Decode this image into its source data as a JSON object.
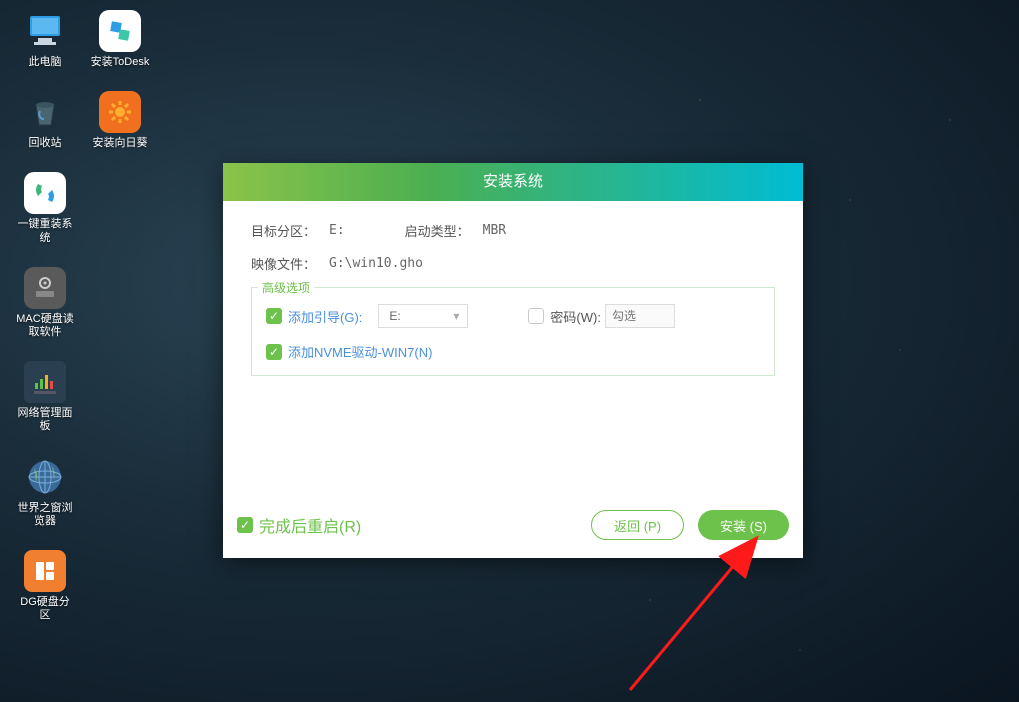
{
  "desktop": {
    "col1": [
      {
        "name": "this-pc",
        "label": "此电脑"
      },
      {
        "name": "recycle-bin",
        "label": "回收站"
      },
      {
        "name": "one-key-reinstall",
        "label": "一键重装系统"
      },
      {
        "name": "mac-disk-reader",
        "label": "MAC硬盘读取软件"
      },
      {
        "name": "network-panel",
        "label": "网络管理面板"
      },
      {
        "name": "world-window-browser",
        "label": "世界之窗浏览器"
      },
      {
        "name": "dg-disk-partition",
        "label": "DG硬盘分区"
      }
    ],
    "col2": [
      {
        "name": "install-todesk",
        "label": "安装ToDesk"
      },
      {
        "name": "install-sunflower",
        "label": "安装向日葵"
      }
    ]
  },
  "dialog": {
    "title": "安装系统",
    "target_partition_label": "目标分区：",
    "target_partition_value": "E:",
    "boot_type_label": "启动类型：",
    "boot_type_value": "MBR",
    "image_file_label": "映像文件：",
    "image_file_value": "G:\\win10.gho",
    "advanced_legend": "高级选项",
    "add_boot_label": "添加引导(G):",
    "add_boot_value": "E:",
    "password_label": "密码(W):",
    "password_placeholder": "勾选",
    "add_nvme_label": "添加NVME驱动-WIN7(N)",
    "restart_after_label": "完成后重启(R)",
    "back_btn": "返回 (P)",
    "install_btn": "安装 (S)"
  }
}
